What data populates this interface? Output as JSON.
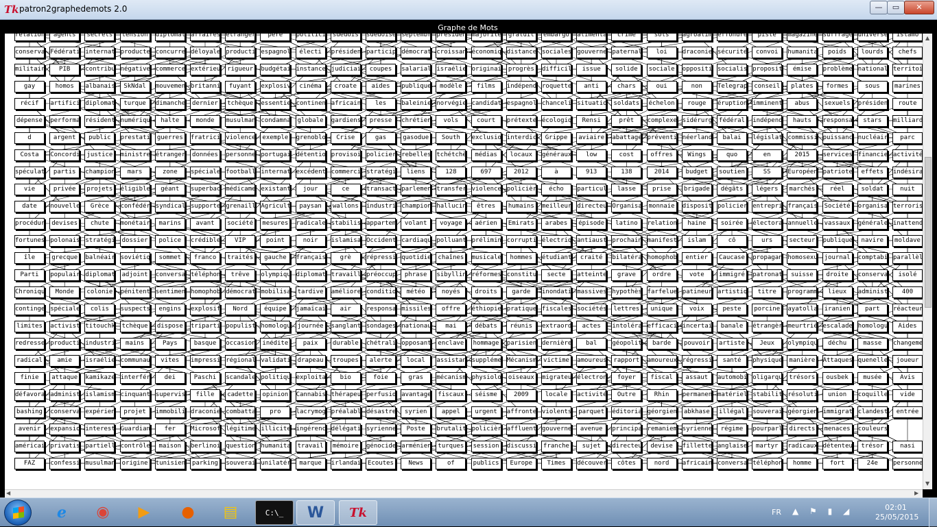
{
  "window": {
    "app_icon": "Tk",
    "title": "patron2graphedemots 2.0",
    "minimize": "—",
    "maximize": "▭",
    "close": "✕"
  },
  "canvas": {
    "title": "Graphe de Mots"
  },
  "graph": {
    "rows": [
      [
        "relation",
        "agents",
        "secrets",
        "tension",
        "diplomatique",
        "affaires",
        "étrangères",
        "père",
        "politicien",
        "suédois",
        "suédoises",
        "septembre",
        "présidentiel",
        "majorité",
        "gratuit",
        "embargo",
        "alimentaire",
        "crime",
        "sols",
        "agroalimentaire",
        "effondrée",
        "piste",
        "magazine",
        "suffrage",
        "universel",
        "islamo"
      ],
      [
        "conservateurs",
        "Fédération",
        "international",
        "producteurs",
        "concurrence",
        "déloyale",
        "production",
        "espagnoles",
        "électi",
        "présidentielle",
        "participation",
        "démocratique",
        "croissance",
        "économique",
        "distances",
        "sociales",
        "gouvernement",
        "paternaliste",
        "loi",
        "draconien",
        "sécurité",
        "convoi",
        "humanitaire",
        "poids",
        "lourds",
        "chefs"
      ],
      [
        "militaires",
        "PIB",
        "contribution",
        "négative",
        "commerce",
        "extérieur",
        "rigueur",
        "budgétaire",
        "instance",
        "judiciaire",
        "coupes",
        "salariales",
        "israéliennes",
        "originaires",
        "progrès",
        "difficiles",
        "issue",
        "solide",
        "sociale",
        "opposition",
        "socialiste",
        "proposition",
        "émise",
        "problème",
        "national",
        "territoire"
      ],
      [
        "gay",
        "homos",
        "albanais",
        "SkNdal",
        "mouvement",
        "britannique",
        "fuyant",
        "explosive",
        "cinéma",
        "croate",
        "aides",
        "publiques",
        "modèle",
        "films",
        "indépendants",
        "roquettes",
        "anti",
        "chars",
        "oui",
        "non",
        "Telegraph",
        "conseil",
        "plates",
        "formes",
        "sous",
        "marines"
      ],
      [
        "récif",
        "artificiel",
        "diplomatie",
        "turque",
        "dimanche",
        "dernier",
        "tchèque",
        "essentielle",
        "continent",
        "africain",
        "les",
        "baleiniers",
        "norvégien",
        "candidature",
        "espagnol",
        "chancelière",
        "situation",
        "soldats",
        "échelon",
        "rouge",
        "éruption",
        "imminente",
        "abus",
        "sexuels",
        "présidents",
        "route"
      ],
      [
        "dépense",
        "performance",
        "résident",
        "numérique",
        "halte",
        "monde",
        "musulman",
        "condamnation",
        "globale",
        "gardiens",
        "presse",
        "chrétiens",
        "vols",
        "court",
        "prétexte",
        "écologique",
        "Rensi",
        "prêt",
        "complexe",
        "sidérurgique",
        "fédéral",
        "indépendantiste",
        "hauts",
        "responsables",
        "stars",
        "milliards"
      ],
      [
        "d",
        "argent",
        "public",
        "prestations",
        "guerres",
        "fratricides",
        "violence",
        "exemple",
        "grenoblois",
        "Crise",
        "gas",
        "gasodue",
        "South",
        "exclusion",
        "interdiction",
        "Grippe",
        "aviaire",
        "abattage",
        "préventif",
        "néerlandaise",
        "balai",
        "législatives",
        "commission",
        "puissance",
        "nucléaire",
        "parc"
      ],
      [
        "Costa",
        "Concordia",
        "justice",
        "ministres",
        "étrangers",
        "données",
        "personnelles",
        "portugais",
        "détention",
        "provisoire",
        "policiers",
        "rebelles",
        "tchétchènes",
        "médias",
        "locaux",
        "généraux",
        "low",
        "cost",
        "offres",
        "Wings",
        "quo",
        "en",
        "2015",
        "services",
        "financiers",
        "activités"
      ],
      [
        "spéculatives",
        "partis",
        "championnat",
        "mars",
        "zone",
        "spéciale",
        "football",
        "international",
        "excédent",
        "commercial",
        "stratégique",
        "liens",
        "128",
        "697",
        "2012",
        "à",
        "913",
        "138",
        "2014",
        "budget",
        "soutien",
        "SS",
        "Européens",
        "patriotes",
        "effets",
        "indésirables"
      ],
      [
        "vie",
        "privée",
        "projets",
        "éligibles",
        "géant",
        "superbactérie",
        "médicament",
        "existants",
        "jour",
        "ce",
        "transaction",
        "parlementaire",
        "transferts",
        "violences",
        "policières",
        "écho",
        "particulier",
        "lasse",
        "prise",
        "brigade",
        "dégâts",
        "légers",
        "marchés",
        "réel",
        "soldat",
        "nuit"
      ],
      [
        "date",
        "nouvelle",
        "Grèce",
        "confédération",
        "syndicale",
        "supporteurs",
        "grenaille",
        "Agriculteurs",
        "paysan",
        "wallons",
        "industrielle",
        "champion",
        "hallucinogènes",
        "êtres",
        "humains",
        "meilleure",
        "directeur",
        "Organisation",
        "monnaie",
        "dispositif",
        "policiers",
        "entreprises",
        "françaises",
        "Société",
        "organisations",
        "terroristes"
      ],
      [
        "procédure",
        "devises",
        "chute",
        "monétaire",
        "marins",
        "avant",
        "société",
        "mesures",
        "radicales",
        "stabilisation",
        "appartement",
        "volant",
        "voyage",
        "aérien",
        "Emirats",
        "arabes",
        "épisode",
        "latino",
        "relations",
        "haine",
        "soirée",
        "électorale",
        "annuelle",
        "vassaux",
        "générales",
        "inattendus"
      ],
      [
        "fortunes",
        "polonais",
        "stratégie",
        "dossier",
        "police",
        "crédibles",
        "VIP",
        "point",
        "noir",
        "islamisation",
        "Occident",
        "cardiaque",
        "polluantes",
        "préliminaires",
        "corruption",
        "électriques",
        "antiaustérité",
        "prochain",
        "manifestations",
        "islam",
        "cô",
        "urs",
        "secteur",
        "publique",
        "navire",
        "moldave"
      ],
      [
        "île",
        "grecque",
        "balnéaire",
        "soviétique",
        "sommet",
        "franco",
        "traités",
        "gauche",
        "française",
        "grè",
        "répressive",
        "quotidien",
        "chaînes",
        "musicales",
        "hommes",
        "étudiante",
        "craité",
        "bilatéral",
        "homophobe",
        "entier",
        "Caucase",
        "propagande",
        "homosexuelle",
        "journal",
        "comptabilité",
        "parallèle"
      ],
      [
        "Parti",
        "populaire",
        "diplomate",
        "adjoint",
        "conversation",
        "téléphonique",
        "trêve",
        "olympique",
        "diplomatie",
        "travailleurs",
        "préoccupation",
        "phrase",
        "sibylline",
        "réformes",
        "constitutionnelles",
        "secte",
        "atteinte",
        "grave",
        "ordre",
        "vote",
        "immigré",
        "patronat",
        "suisse",
        "droite",
        "conservatrice",
        "isolé"
      ],
      [
        "Chronique",
        "Monde",
        "colonie",
        "pénitentiaire",
        "sentiment",
        "homophobe",
        "démocratie",
        "mobilisation",
        "tardive",
        "améliorer",
        "conditions",
        "météo",
        "noyés",
        "droits",
        "garde",
        "inondations",
        "massives",
        "hypothèse",
        "farfelue",
        "patineur",
        "artistique",
        "titre",
        "programme",
        "lieux",
        "administratifs",
        "400"
      ],
      [
        "contingent",
        "spéciales",
        "colis",
        "suspects",
        "engins",
        "explosifs",
        "Nord",
        "équipe",
        "jamaïcaine",
        "air",
        "responsables",
        "missiles",
        "offre",
        "éthiopien",
        "pratiques",
        "fiscales",
        "sociétés",
        "lettres",
        "unique",
        "voix",
        "peste",
        "porcine",
        "ayatollah",
        "iranien",
        "part",
        "réacteur"
      ],
      [
        "limites",
        "activistes",
        "titouchkis",
        "tchèque",
        "dispose",
        "tripartite",
        "populiste",
        "homologue",
        "journée",
        "sanglante",
        "sondages",
        "nationaux",
        "mai",
        "débats",
        "réunis",
        "extraordinaire",
        "actes",
        "intolérables",
        "efficacité",
        "incertaine",
        "banale",
        "étrangère",
        "meurtrière",
        "escalade",
        "homologues",
        "Aides"
      ],
      [
        "redressement",
        "productif",
        "industrie",
        "mains",
        "Pays",
        "basque",
        "occasion",
        "inédite",
        "paix",
        "durable",
        "chétralisation",
        "opposante",
        "enclave",
        "hommage",
        "parisien",
        "dernière",
        "bal",
        "géopolitiques",
        "barde",
        "pouvoir",
        "artiste",
        "Jeux",
        "olympiques",
        "déchu",
        "masse",
        "changement"
      ],
      [
        "radical",
        "amie",
        "israélien",
        "communauté",
        "vites",
        "impressionnant",
        "régional",
        "validation",
        "drapeau",
        "troupes",
        "alerte",
        "local",
        "assistance",
        "supplémentaires",
        "Mécanisme",
        "victime",
        "amoureuse",
        "rapport",
        "amoureux",
        "régression",
        "santé",
        "physique",
        "manière",
        "Attaques",
        "quenelle",
        "joueur"
      ],
      [
        "finie",
        "attaque",
        "kamikaze",
        "interférences",
        "dei",
        "Paschi",
        "scandale",
        "politique",
        "exploitation",
        "bio",
        "foie",
        "gras",
        "mécanisme",
        "physiologique",
        "oiseaux",
        "migrateurs",
        "électronique",
        "foyer",
        "fiscal",
        "assaut",
        "automobile",
        "oligarque",
        "trésors",
        "ousbek",
        "musée",
        "Avis"
      ],
      [
        "défavorable",
        "administrative",
        "islamisme",
        "cinquante",
        "supervision",
        "fille",
        "cadette",
        "opinion",
        "Cannabis",
        "thérapeutique",
        "perfusion",
        "avantages",
        "fiscaux",
        "séisme",
        "2009",
        "locale",
        "activité",
        "Outre",
        "Rhin",
        "permanence",
        "matériels",
        "stabilité",
        "résolution",
        "union",
        "coquille",
        "vide"
      ],
      [
        "bashing",
        "conservateurs",
        "expérience",
        "projet",
        "immobilier",
        "draconiens",
        "combattants",
        "pro",
        "lacrymogènes",
        "préalables",
        "désastre",
        "syrien",
        "appel",
        "urgent",
        "affrontement",
        "violents",
        "parquet",
        "éditorial",
        "géorgiens",
        "abkhase",
        "illégal",
        "souveraine",
        "géorgienne",
        "immigration",
        "clandestine",
        "entrée"
      ],
      [
        "avenir",
        "expansion",
        "interest",
        "Guardian",
        "fer",
        "Microsoft",
        "légitime",
        "illicite",
        "ingérence",
        "délégation",
        "syrienne",
        "Poste",
        "brutalité",
        "policière",
        "affluent",
        "gouvernemental",
        "avenue",
        "principal",
        "remaniement",
        "syrienne",
        "régime",
        "pourparlers",
        "directs",
        "menaces",
        "couleurs"
      ],
      [
        "américains",
        "privatisation",
        "partielle",
        "contrôle",
        "maison",
        "berlinoise",
        "question",
        "humanitaires",
        "travail",
        "mémoire",
        "génocide",
        "arménien",
        "turques",
        "session",
        "discussion",
        "franche",
        "sujet",
        "directeurs",
        "devise",
        "fillette",
        "anglaise",
        "martyr",
        "radicaux",
        "détenteur",
        "trésor",
        "nasi"
      ],
      [
        "FAZ",
        "confession",
        "musulmane",
        "origine",
        "tunisienne",
        "parking",
        "souverain",
        "unilatérale",
        "marque",
        "irlandaise",
        "Ecoutes",
        "News",
        "of",
        "publics",
        "Europe",
        "Times",
        "découverte",
        "côtes",
        "nord",
        "africain",
        "conversation",
        "téléphonique",
        "homme",
        "fort",
        "24e",
        "personnes"
      ]
    ]
  },
  "taskbar": {
    "items": [
      "internet-explorer",
      "chrome",
      "media-player",
      "firefox",
      "file-explorer",
      "command-prompt",
      "word",
      "tk-app"
    ],
    "icons": {
      "ie": "e",
      "chrome": "◉",
      "media": "▶",
      "firefox": "●",
      "explorer": "▤",
      "cmd": "C:\\_",
      "word": "W",
      "tk": "Tk"
    },
    "lang": "FR",
    "tray": "▲ ⚑ ▮ ◢",
    "time": "02:01",
    "date": "25/05/2015"
  }
}
